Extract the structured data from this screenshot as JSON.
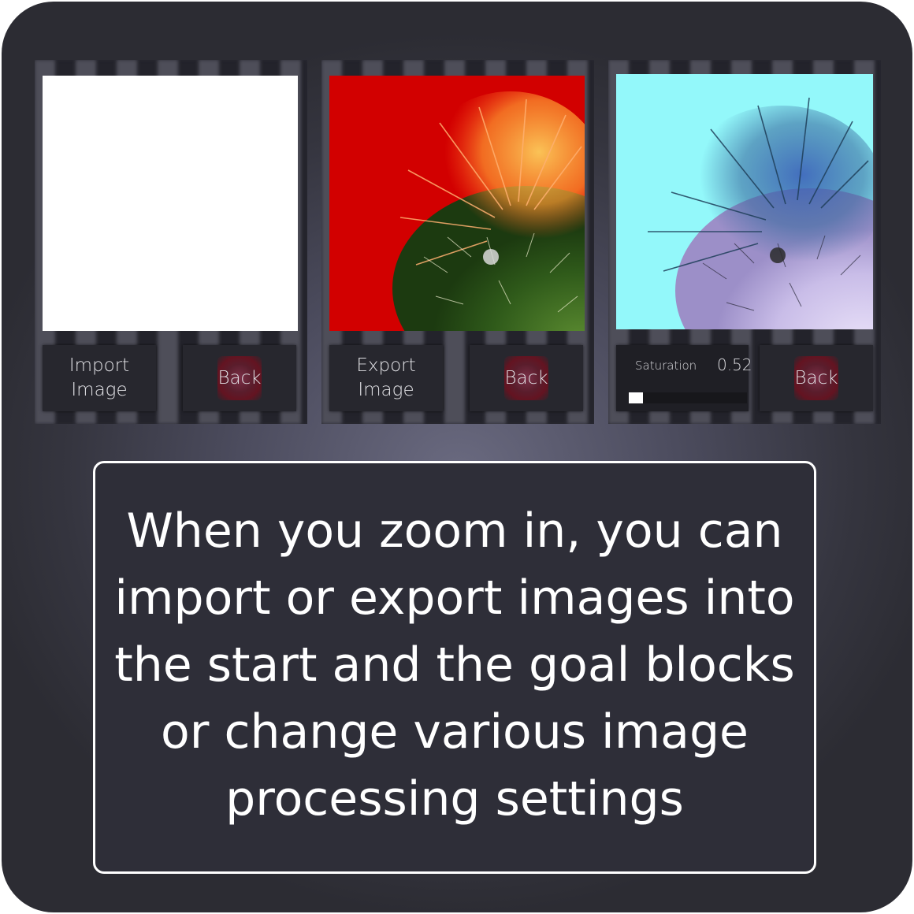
{
  "panels": [
    {
      "action_label": "Import\nImage",
      "back_label": "Back",
      "image": "blank-white-image"
    },
    {
      "action_label": "Export\nImage",
      "back_label": "Back",
      "image": "cactus-on-red-photo"
    },
    {
      "setting_label": "Saturation",
      "setting_value": "0.52",
      "setting_level": 0.12,
      "back_label": "Back",
      "image": "cactus-on-cyan-inverted-photo"
    }
  ],
  "caption": "When you zoom in, you can import or export images into the start and the goal blocks or change various image processing settings",
  "colors": {
    "accent_red": "#d20000",
    "accent_cyan": "#93f8fa"
  }
}
